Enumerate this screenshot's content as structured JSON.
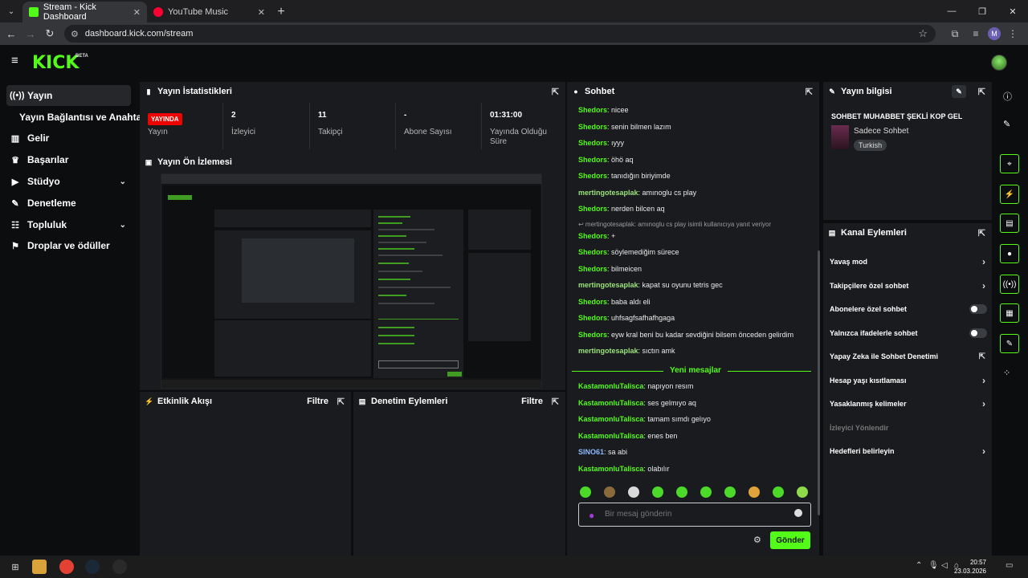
{
  "browser": {
    "tabs": [
      {
        "title": "Stream - Kick Dashboard",
        "active": true
      },
      {
        "title": "YouTube Music",
        "active": false
      }
    ],
    "url": "dashboard.kick.com/stream",
    "profile_initial": "M"
  },
  "header": {
    "logo": "KICK",
    "beta": "BETA"
  },
  "sidebar": {
    "items": [
      {
        "label": "Yayın",
        "icon": "broadcast-icon"
      },
      {
        "label": "Yayın Bağlantısı ve Anahtarı"
      },
      {
        "label": "Gelir",
        "icon": "chart-icon"
      },
      {
        "label": "Başarılar",
        "icon": "trophy-icon"
      },
      {
        "label": "Stüdyo",
        "icon": "video-icon"
      },
      {
        "label": "Denetleme",
        "icon": "wrench-icon"
      },
      {
        "label": "Topluluk",
        "icon": "people-icon"
      },
      {
        "label": "Droplar ve ödüller",
        "icon": "gift-icon"
      }
    ]
  },
  "stats": {
    "title": "Yayın İstatistikleri",
    "status_badge": "YAYINDA",
    "status_label": "Yayın",
    "viewers_value": "2",
    "viewers_label": "İzleyici",
    "followers_value": "11",
    "followers_label": "Takipçi",
    "subs_value": "-",
    "subs_label": "Abone Sayısı",
    "duration_value": "01:31:00",
    "duration_label": "Yayında Olduğu Süre"
  },
  "preview": {
    "title": "Yayın Ön İzlemesi"
  },
  "activity": {
    "title": "Etkinlik Akışı",
    "filter": "Filtre"
  },
  "moderation": {
    "title": "Denetim Eylemleri",
    "filter": "Filtre"
  },
  "chat": {
    "title": "Sohbet",
    "messages": [
      {
        "user": "Shedors",
        "text": "nicee",
        "color": "#53fc18"
      },
      {
        "user": "Shedors",
        "text": "senin bilmen lazım",
        "color": "#53fc18"
      },
      {
        "user": "Shedors",
        "text": "ıyyy",
        "color": "#53fc18"
      },
      {
        "user": "Shedors",
        "text": "öhö aq",
        "color": "#53fc18"
      },
      {
        "user": "Shedors",
        "text": "tanıdığın biriyimde",
        "color": "#53fc18"
      },
      {
        "user": "mertingotesaplak",
        "text": "amınoglu cs play",
        "color": "#9be37a"
      },
      {
        "user": "Shedors",
        "text": "nerden bilcen aq",
        "color": "#53fc18"
      },
      {
        "user": "Shedors",
        "text": "+",
        "color": "#53fc18",
        "reply": "mertingotesaplak: amınoglu cs play isimli kullanıcıya yanıt veriyor"
      },
      {
        "user": "Shedors",
        "text": "söylemediğim sürece",
        "color": "#53fc18"
      },
      {
        "user": "Shedors",
        "text": "bilmeicen",
        "color": "#53fc18"
      },
      {
        "user": "mertingotesaplak",
        "text": "kapat su oyunu tetris gec",
        "color": "#9be37a"
      },
      {
        "user": "Shedors",
        "text": "baba aldı eli",
        "color": "#53fc18"
      },
      {
        "user": "Shedors",
        "text": "uhfsagfsafhafhgaga",
        "color": "#53fc18"
      },
      {
        "user": "Shedors",
        "text": "eyw kral beni bu kadar sevdiğini bilsem önceden gelirdim",
        "color": "#53fc18"
      },
      {
        "user": "mertingotesaplak",
        "text": "sıctın amk",
        "color": "#9be37a"
      }
    ],
    "new_messages_label": "Yeni mesajlar",
    "new_messages": [
      {
        "user": "KastamonluTalisca",
        "text": "napıyon resım",
        "color": "#53fc18"
      },
      {
        "user": "KastamonluTalisca",
        "text": "ses gelmıyo aq",
        "color": "#53fc18"
      },
      {
        "user": "KastamonluTalisca",
        "text": "tamam sımdı gelıyo",
        "color": "#53fc18"
      },
      {
        "user": "KastamonluTalisca",
        "text": "enes ben",
        "color": "#53fc18"
      },
      {
        "user": "SINO61",
        "text": "sa abi",
        "color": "#8fb8ff"
      },
      {
        "user": "KastamonluTalisca",
        "text": "olabılır",
        "color": "#53fc18"
      }
    ],
    "input_placeholder": "Bir mesaj gönderin",
    "send_label": "Gönder"
  },
  "stream_info": {
    "title": "Yayın bilgisi",
    "stream_title": "SOHBET MUHABBET ŞEKLİ KOP GEL",
    "category": "Sadece Sohbet",
    "tag": "Turkish"
  },
  "channel_actions": {
    "title": "Kanal Eylemleri",
    "rows": [
      {
        "label": "Yavaş mod",
        "control": "arrow"
      },
      {
        "label": "Takipçilere özel sohbet",
        "control": "arrow"
      },
      {
        "label": "Abonelere özel sohbet",
        "control": "toggle"
      },
      {
        "label": "Yalnızca ifadelerle sohbet",
        "control": "toggle"
      },
      {
        "label": "Yapay Zeka ile Sohbet Denetimi",
        "control": "external"
      },
      {
        "label": "Hesap yaşı kısıtlaması",
        "control": "arrow"
      },
      {
        "label": "Yasaklanmış kelimeler",
        "control": "arrow"
      },
      {
        "label": "İzleyici Yönlendir",
        "control": "none",
        "disabled": true
      },
      {
        "label": "Hedefleri belirleyin",
        "control": "arrow"
      }
    ]
  },
  "taskbar": {
    "time": "20:57",
    "date": "23.03.2026"
  },
  "colors": {
    "accent": "#53fc18",
    "live": "#eb0400",
    "panel": "#191b1f"
  }
}
